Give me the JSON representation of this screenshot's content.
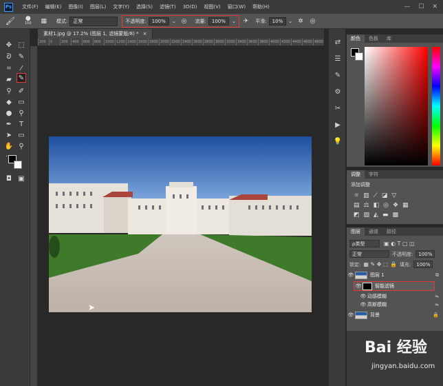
{
  "app": {
    "logo": "Ps"
  },
  "menus": [
    "文件(F)",
    "编辑(E)",
    "图像(I)",
    "图层(L)",
    "文字(Y)",
    "选择(S)",
    "滤镜(T)",
    "3D(D)",
    "视图(V)",
    "窗口(W)",
    "帮助(H)"
  ],
  "options": {
    "brush_size": "150",
    "mode_label": "模式:",
    "mode_value": "正常",
    "opacity_label": "不透明度:",
    "opacity_value": "100%",
    "flow_label": "流量:",
    "flow_value": "100%",
    "smoothing_label": "平滑:",
    "smoothing_value": "10%"
  },
  "document": {
    "tab_title": "素材1.jpg @ 17.2% (图层 1, 滤镜蒙版/8) *",
    "close": "×"
  },
  "ruler_ticks": [
    "200",
    "0",
    "200",
    "400",
    "600",
    "800",
    "1000",
    "1200",
    "1400",
    "1600",
    "1800",
    "2000",
    "2200",
    "2400",
    "2600",
    "2800",
    "3000",
    "3200",
    "3400",
    "3600",
    "3800",
    "4000",
    "4200",
    "4400",
    "4600",
    "4800"
  ],
  "color_panel": {
    "tabs": [
      "颜色",
      "色板",
      "库"
    ]
  },
  "adjustments_panel": {
    "tabs": [
      "调整",
      "字符"
    ],
    "add_label": "添加调整"
  },
  "layers_panel": {
    "tabs": [
      "图层",
      "通道",
      "路径"
    ],
    "filter_kind": "ρ类型",
    "blend_mode": "正常",
    "opacity_label": "不透明度:",
    "opacity_value": "100%",
    "lock_label": "锁定:",
    "fill_label": "填充:",
    "fill_value": "100%",
    "layers": [
      {
        "name": "图层 1"
      },
      {
        "name": "智能滤镜"
      },
      {
        "name": "动感模糊"
      },
      {
        "name": "高斯模糊"
      },
      {
        "name": "背景"
      }
    ]
  },
  "watermark": {
    "logo": "Bai  经验",
    "url": "jingyan.baidu.com"
  },
  "colors": {
    "accent": "#e23a3a",
    "panel": "#535353",
    "dark": "#282828"
  }
}
